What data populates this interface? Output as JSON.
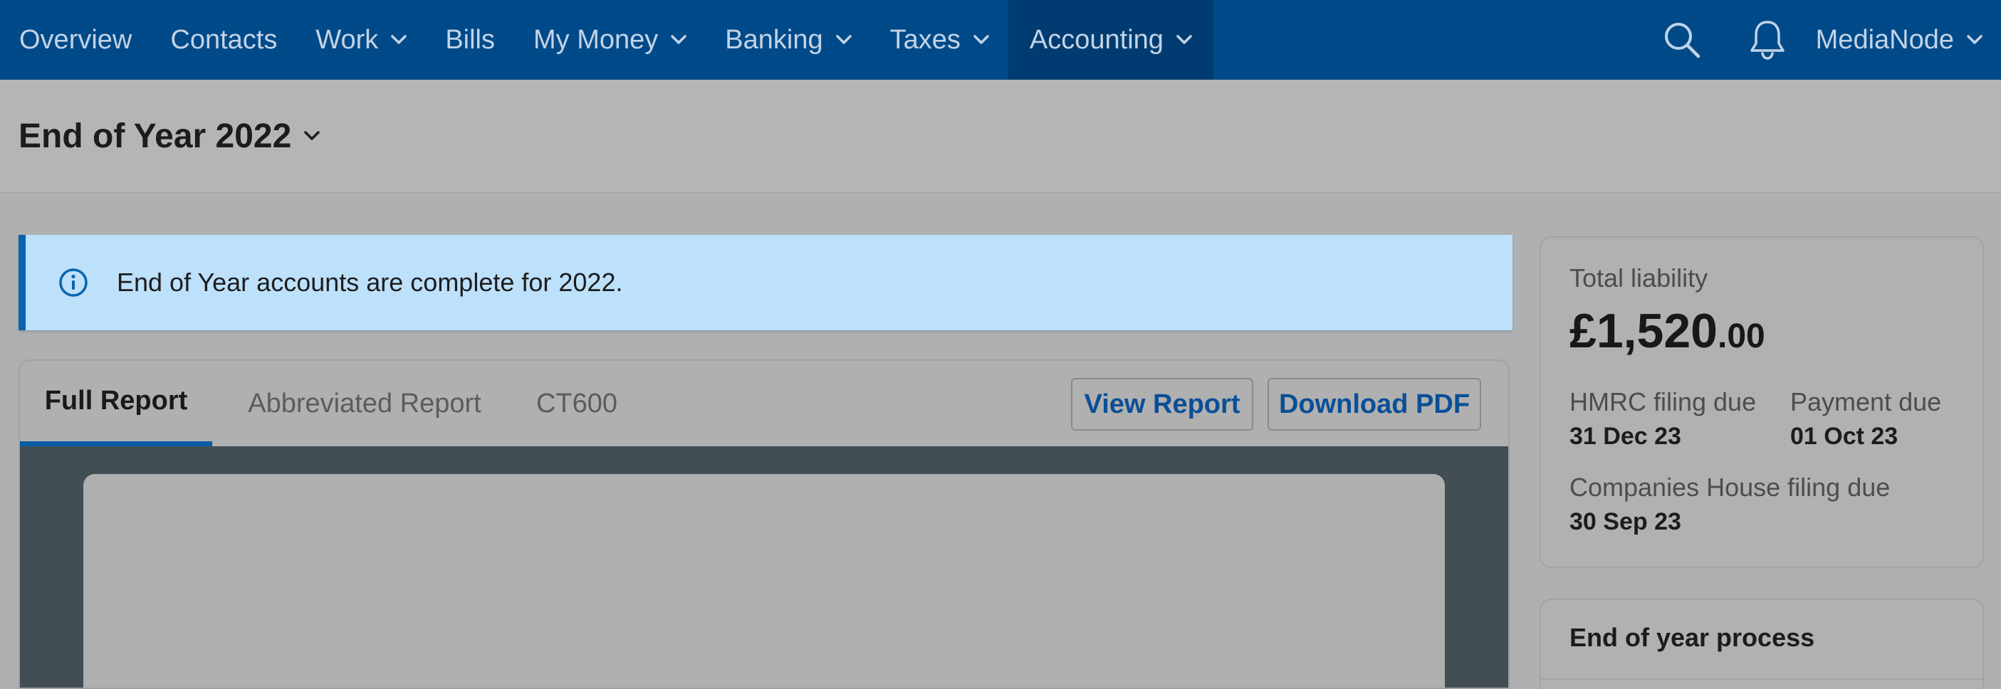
{
  "nav": {
    "items": [
      {
        "label": "Overview"
      },
      {
        "label": "Contacts"
      },
      {
        "label": "Work"
      },
      {
        "label": "Bills"
      },
      {
        "label": "My Money"
      },
      {
        "label": "Banking"
      },
      {
        "label": "Taxes"
      },
      {
        "label": "Accounting"
      }
    ],
    "active": "Accounting",
    "account_name": "MediaNode"
  },
  "header": {
    "title": "End of Year 2022"
  },
  "alert": {
    "text": "End of Year accounts are complete for 2022."
  },
  "report": {
    "tabs": [
      {
        "label": "Full Report"
      },
      {
        "label": "Abbreviated Report"
      },
      {
        "label": "CT600"
      }
    ],
    "active_tab": "Full Report",
    "view_button": "View Report",
    "download_button": "Download PDF"
  },
  "summary": {
    "total_label": "Total liability",
    "total_main": "£1,520",
    "total_pence": ".00",
    "hmrc_label": "HMRC filing due",
    "hmrc_date": "31 Dec 23",
    "payment_label": "Payment due",
    "payment_date": "01 Oct 23",
    "ch_label": "Companies House filing due",
    "ch_date": "30 Sep 23"
  },
  "process": {
    "title": "End of year process"
  },
  "colors": {
    "nav_bg": "#004a89",
    "nav_active_bg": "#003c71",
    "alert_bg": "#bde0fb",
    "alert_accent": "#0a64ad",
    "link_blue": "#0a4f97"
  }
}
